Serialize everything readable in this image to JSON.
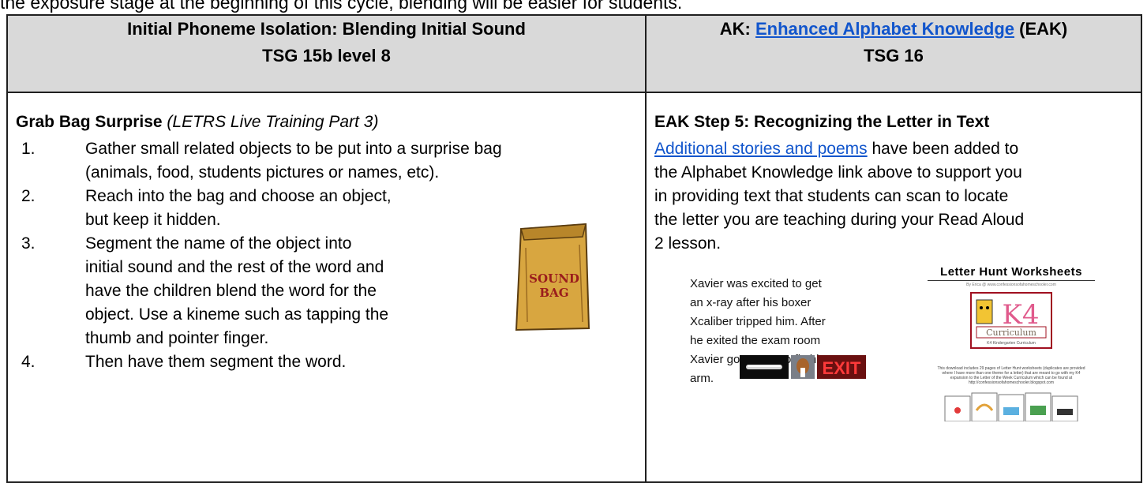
{
  "top_text": "the exposure stage at the beginning of this cycle, blending will be easier for students.",
  "headers": {
    "left_line1": "Initial Phoneme Isolation: Blending Initial Sound",
    "left_line2": "TSG 15b level 8",
    "right_prefix": "AK: ",
    "right_link": "Enhanced Alphabet Knowledge",
    "right_suffix": " (EAK)",
    "right_line2": "TSG 16"
  },
  "left": {
    "title": "Grab Bag Surprise",
    "title_note": "(LETRS Live Training Part 3)",
    "steps": [
      {
        "num": "1.",
        "lines": [
          "Gather small related objects to be put into a surprise bag",
          "(animals, food, students pictures or names, etc)."
        ]
      },
      {
        "num": "2.",
        "lines": [
          "Reach into the bag and choose an object,",
          "but keep it hidden."
        ]
      },
      {
        "num": "3.",
        "lines": [
          "Segment the name of the object into",
          "initial sound and the rest of the word and",
          "have the children blend the word for the",
          "object. Use a kineme such as tapping the",
          "thumb and pointer finger."
        ]
      },
      {
        "num": "4.",
        "lines": [
          "Then have them segment the word."
        ]
      }
    ],
    "bag_label_line1": "SOUND",
    "bag_label_line2": "BAG"
  },
  "right": {
    "title": "EAK Step 5: Recognizing the Letter in Text",
    "link_text": "Additional stories and poems",
    "text_lines": [
      " have been added to",
      "the Alphabet Knowledge link above to support you",
      "in providing text that students can scan to locate",
      "the letter you are teaching during your Read Aloud",
      "2 lesson."
    ],
    "xavier_lines": [
      "Xavier was excited to get",
      "an x-ray after his boxer",
      "Xcaliber tripped him. After",
      "he exited the exam room",
      "Xavier got a cast to fix his",
      "arm."
    ],
    "exit_sign": "EXIT",
    "worksheet_title": "Letter Hunt Worksheets",
    "worksheet_byline": "By Erica @ www.confessionsofahomeschooler.com",
    "logo_text": "K4",
    "logo_word": "Curriculum",
    "logo_sub": "K4 Kindergarten Curriculum",
    "worksheet_desc": "This download includes 29 pages of Letter Hunt worksheets (duplicates are provided where I have more than one theme for a letter) that are meant to go with my K4 expansion to the Letter of the Week Curriculum which can be found at http://confessionsofahomeschooler.blogspot.com"
  }
}
